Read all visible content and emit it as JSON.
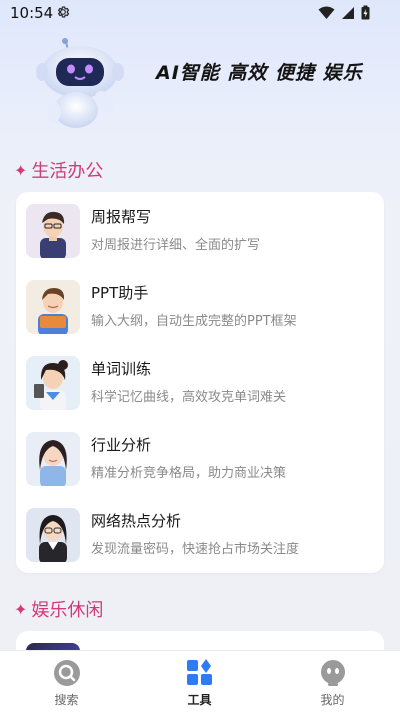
{
  "status_bar": {
    "time": "10:54"
  },
  "hero": {
    "slogan": "AI智能 高效 便捷 娱乐"
  },
  "sections": [
    {
      "title": "生活办公",
      "items": [
        {
          "title": "周报帮写",
          "desc": "对周报进行详细、全面的扩写",
          "avatar": "man-avatar"
        },
        {
          "title": "PPT助手",
          "desc": "输入大纲，自动生成完整的PPT框架",
          "avatar": "man-avatar"
        },
        {
          "title": "单词训练",
          "desc": "科学记忆曲线，高效攻克单词难关",
          "avatar": "woman-avatar"
        },
        {
          "title": "行业分析",
          "desc": "精准分析竞争格局，助力商业决策",
          "avatar": "woman-avatar"
        },
        {
          "title": "网络热点分析",
          "desc": "发现流量密码，快速抢占市场关注度",
          "avatar": "woman-avatar"
        }
      ]
    },
    {
      "title": "娱乐休闲"
    }
  ],
  "bottom_nav": [
    {
      "label": "搜索",
      "icon": "search-icon"
    },
    {
      "label": "工具",
      "icon": "tools-icon",
      "active": true
    },
    {
      "label": "我的",
      "icon": "profile-icon"
    }
  ],
  "colors": {
    "accent": "#d23a78",
    "tools_blue": "#2f7bf6",
    "card_bg": "#ffffff"
  }
}
